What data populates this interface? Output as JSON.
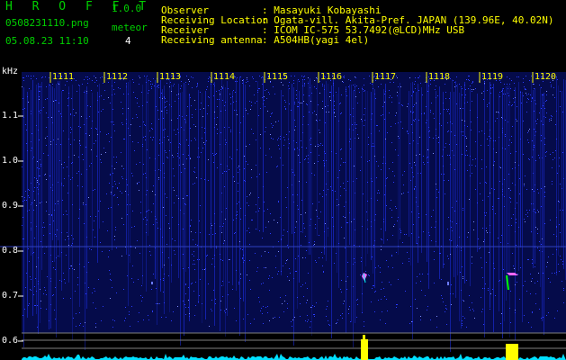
{
  "header": {
    "brand": "H R O F F T",
    "version": "1.0.0",
    "filename": "0508231110.png",
    "datetime": "05.08.23 11:10",
    "meteor_label": "meteor",
    "meteor_count": "4"
  },
  "station": {
    "labels": [
      "Observer",
      "Receiving Location",
      "Receiver",
      "Receiving antenna"
    ],
    "values": [
      ": Masayuki Kobayashi",
      ": Ogata-vill. Akita-Pref. JAPAN (139.96E, 40.02N)",
      ": ICOM IC-575 53.7492(@LCD)MHz USB",
      ": A504HB(yagi 4el)"
    ]
  },
  "axes": {
    "unit": "kHz",
    "time_ticks": [
      "1111",
      "1112",
      "1113",
      "1114",
      "1115",
      "1116",
      "1117",
      "1118",
      "1119",
      "1120"
    ],
    "freq_ticks": [
      "1.1",
      "1.0",
      "0.9",
      "0.8",
      "0.7",
      "0.6"
    ]
  },
  "colors": {
    "background": "#000000",
    "noise": "#1a2ad0",
    "text_green": "#00d000",
    "tick_yellow": "#ffff00",
    "meteor_pink": "#ff66ff",
    "level_cyan": "#00e0ff"
  }
}
